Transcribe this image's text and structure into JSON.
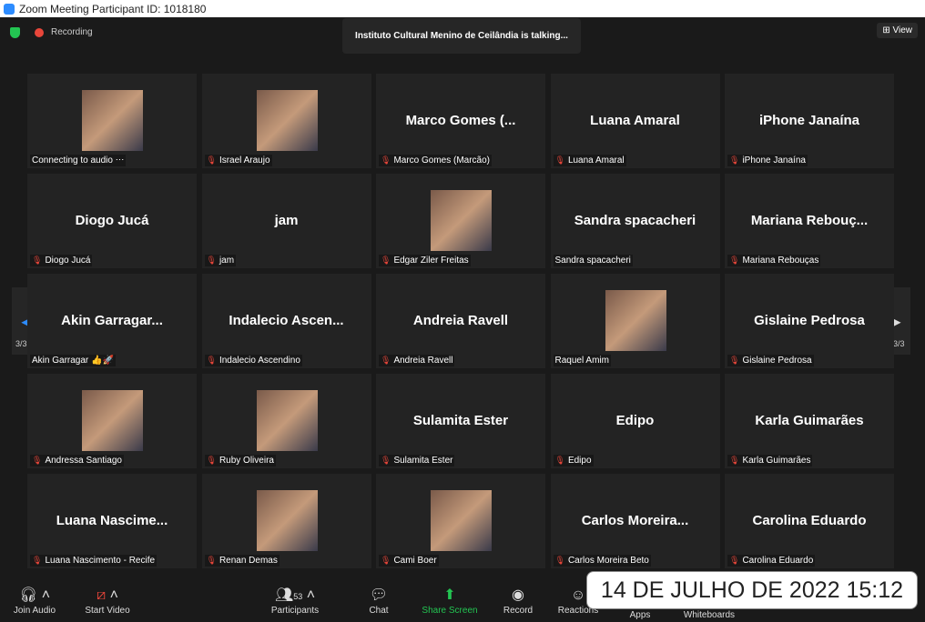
{
  "window": {
    "title": "Zoom Meeting Participant ID: 1018180"
  },
  "topbar": {
    "recording": "Recording",
    "talking": "Instituto Cultural Menino de Ceilândia is talking...",
    "view": "View"
  },
  "pager": {
    "left": "3/3",
    "right": "3/3"
  },
  "tiles": [
    {
      "big": "",
      "name": "Connecting to audio ⋅⋅⋅",
      "video": true,
      "muted": false
    },
    {
      "big": "",
      "name": "Israel Araujo",
      "video": true,
      "muted": true
    },
    {
      "big": "Marco Gomes (...",
      "name": "Marco Gomes (Marcão)",
      "video": false,
      "muted": true
    },
    {
      "big": "Luana Amaral",
      "name": "Luana Amaral",
      "video": false,
      "muted": true
    },
    {
      "big": "iPhone Janaína",
      "name": "iPhone Janaína",
      "video": false,
      "muted": true
    },
    {
      "big": "Diogo Jucá",
      "name": "Diogo Jucá",
      "video": false,
      "muted": true
    },
    {
      "big": "jam",
      "name": "jam",
      "video": false,
      "muted": true
    },
    {
      "big": "",
      "name": "Edgar Ziler Freitas",
      "video": true,
      "muted": true
    },
    {
      "big": "Sandra spacacheri",
      "name": "Sandra spacacheri",
      "video": false,
      "muted": false
    },
    {
      "big": "Mariana Rebouç...",
      "name": "Mariana Rebouças",
      "video": false,
      "muted": true
    },
    {
      "big": "Akin Garragar...",
      "name": "Akin Garragar 👍🚀",
      "video": false,
      "muted": false
    },
    {
      "big": "Indalecio Ascen...",
      "name": "Indalecio Ascendino",
      "video": false,
      "muted": true
    },
    {
      "big": "Andreia Ravell",
      "name": "Andreia Ravell",
      "video": false,
      "muted": true
    },
    {
      "big": "",
      "name": "Raquel Amim",
      "video": true,
      "muted": false
    },
    {
      "big": "Gislaine Pedrosa",
      "name": "Gislaine Pedrosa",
      "video": false,
      "muted": true
    },
    {
      "big": "",
      "name": "Andressa Santiago",
      "video": true,
      "muted": true
    },
    {
      "big": "",
      "name": "Ruby Oliveira",
      "video": true,
      "muted": true
    },
    {
      "big": "Sulamita Ester",
      "name": "Sulamita Ester",
      "video": false,
      "muted": true
    },
    {
      "big": "Edipo",
      "name": "Edipo",
      "video": false,
      "muted": true
    },
    {
      "big": "Karla Guimarães",
      "name": "Karla Guimarães",
      "video": false,
      "muted": true
    },
    {
      "big": "Luana Nascime...",
      "name": "Luana Nascimento - Recife",
      "video": false,
      "muted": true
    },
    {
      "big": "",
      "name": "Renan Demas",
      "video": true,
      "muted": true
    },
    {
      "big": "",
      "name": "Cami Boer",
      "video": true,
      "muted": true
    },
    {
      "big": "Carlos Moreira...",
      "name": "Carlos Moreira Beto",
      "video": false,
      "muted": true
    },
    {
      "big": "Carolina Eduardo",
      "name": "Carolina Eduardo",
      "video": false,
      "muted": true
    }
  ],
  "toolbar": {
    "join_audio": "Join Audio",
    "start_video": "Start Video",
    "participants": "Participants",
    "participants_count": "53",
    "chat": "Chat",
    "share_screen": "Share Screen",
    "record": "Record",
    "reactions": "Reactions",
    "apps": "Apps",
    "whiteboards": "Whiteboards",
    "share_color": "#23c552"
  },
  "timestamp": "14 DE JULHO DE 2022 15:12"
}
